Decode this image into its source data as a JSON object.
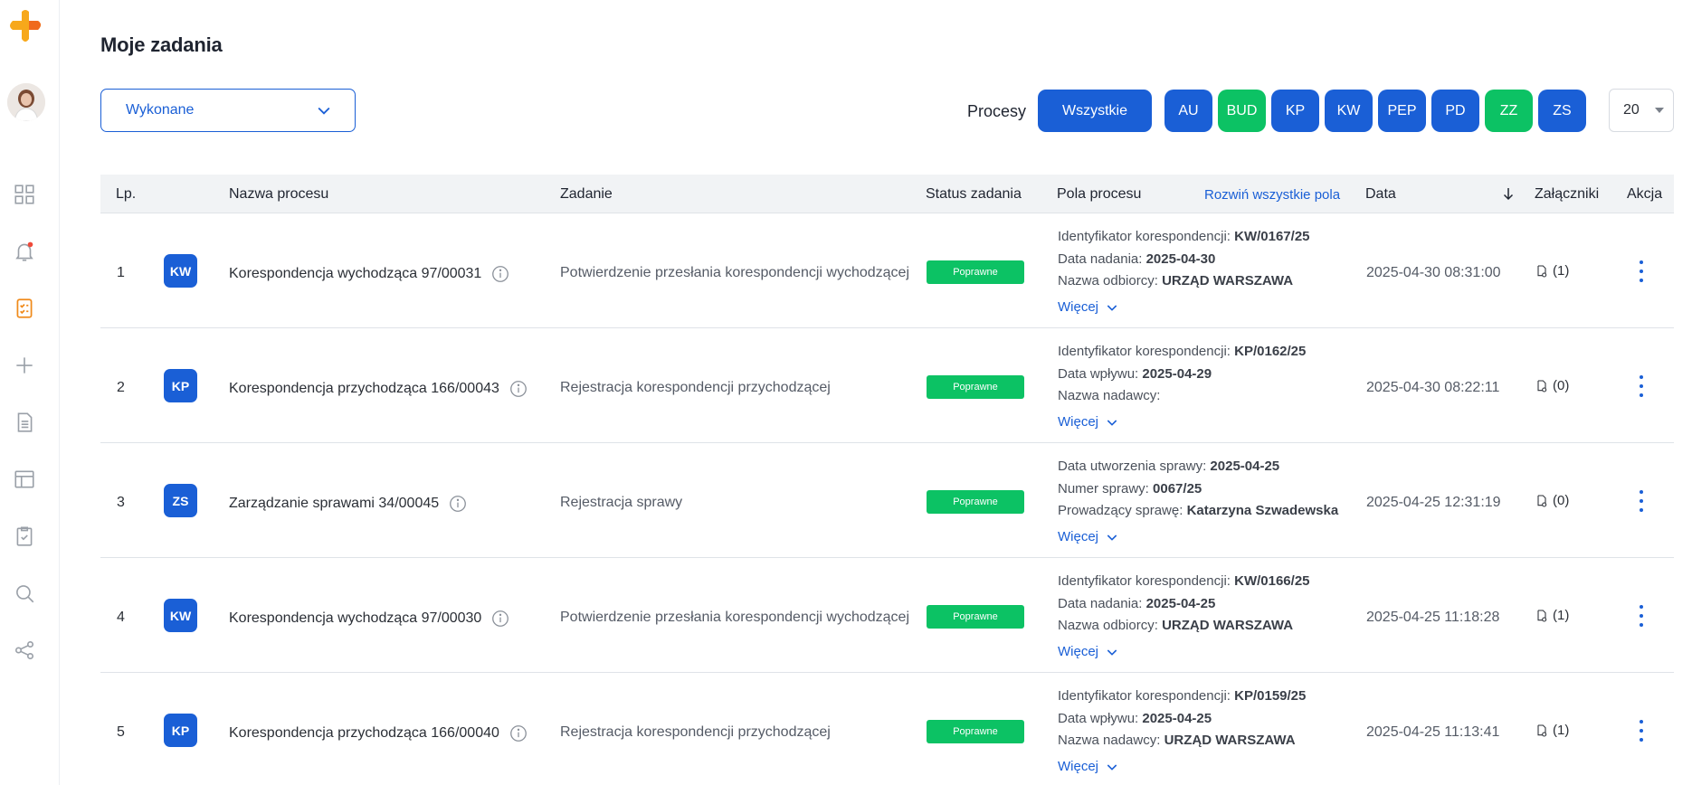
{
  "page": {
    "title": "Moje zadania"
  },
  "filters": {
    "status_value": "Wykonane",
    "processes_label": "Procesy",
    "all_label": "Wszystkie",
    "chips": [
      {
        "label": "AU",
        "color": "#1a5fd6"
      },
      {
        "label": "BUD",
        "color": "#0cc264"
      },
      {
        "label": "KP",
        "color": "#1a5fd6"
      },
      {
        "label": "KW",
        "color": "#1a5fd6"
      },
      {
        "label": "PEP",
        "color": "#1a5fd6"
      },
      {
        "label": "PD",
        "color": "#1a5fd6"
      },
      {
        "label": "ZZ",
        "color": "#0cc264"
      },
      {
        "label": "ZS",
        "color": "#1a5fd6"
      }
    ],
    "page_size": "20"
  },
  "table": {
    "headers": {
      "lp": "Lp.",
      "name": "Nazwa procesu",
      "task": "Zadanie",
      "status": "Status zadania",
      "fields": "Pola procesu",
      "expand_all": "Rozwiń wszystkie pola",
      "date": "Data",
      "attachments": "Załączniki",
      "action": "Akcja"
    },
    "more_label": "Więcej",
    "rows": [
      {
        "lp": "1",
        "badge": "KW",
        "name": "Korespondencja wychodząca 97/00031",
        "task": "Potwierdzenie przesłania korespondencji wychodzącej",
        "status": "Poprawne",
        "fields": [
          {
            "label": "Identyfikator korespondencji:",
            "value": "KW/0167/25"
          },
          {
            "label": "Data nadania:",
            "value": "2025-04-30"
          },
          {
            "label": "Nazwa odbiorcy:",
            "value": "URZĄD WARSZAWA"
          }
        ],
        "date": "2025-04-30 08:31:00",
        "attachments": "(1)"
      },
      {
        "lp": "2",
        "badge": "KP",
        "name": "Korespondencja przychodząca 166/00043",
        "task": "Rejestracja korespondencji przychodzącej",
        "status": "Poprawne",
        "fields": [
          {
            "label": "Identyfikator korespondencji:",
            "value": "KP/0162/25"
          },
          {
            "label": "Data wpływu:",
            "value": "2025-04-29"
          },
          {
            "label": "Nazwa nadawcy:",
            "value": ""
          }
        ],
        "date": "2025-04-30 08:22:11",
        "attachments": "(0)"
      },
      {
        "lp": "3",
        "badge": "ZS",
        "name": "Zarządzanie sprawami 34/00045",
        "task": "Rejestracja sprawy",
        "status": "Poprawne",
        "fields": [
          {
            "label": "Data utworzenia sprawy:",
            "value": "2025-04-25"
          },
          {
            "label": "Numer sprawy:",
            "value": "0067/25"
          },
          {
            "label": "Prowadzący sprawę:",
            "value": "Katarzyna Szwadewska"
          }
        ],
        "date": "2025-04-25 12:31:19",
        "attachments": "(0)"
      },
      {
        "lp": "4",
        "badge": "KW",
        "name": "Korespondencja wychodząca 97/00030",
        "task": "Potwierdzenie przesłania korespondencji wychodzącej",
        "status": "Poprawne",
        "fields": [
          {
            "label": "Identyfikator korespondencji:",
            "value": "KW/0166/25"
          },
          {
            "label": "Data nadania:",
            "value": "2025-04-25"
          },
          {
            "label": "Nazwa odbiorcy:",
            "value": "URZĄD WARSZAWA"
          }
        ],
        "date": "2025-04-25 11:18:28",
        "attachments": "(1)"
      },
      {
        "lp": "5",
        "badge": "KP",
        "name": "Korespondencja przychodząca 166/00040",
        "task": "Rejestracja korespondencji przychodzącej",
        "status": "Poprawne",
        "fields": [
          {
            "label": "Identyfikator korespondencji:",
            "value": "KP/0159/25"
          },
          {
            "label": "Data wpływu:",
            "value": "2025-04-25"
          },
          {
            "label": "Nazwa nadawcy:",
            "value": "URZĄD WARSZAWA"
          }
        ],
        "date": "2025-04-25 11:13:41",
        "attachments": "(1)"
      }
    ]
  }
}
